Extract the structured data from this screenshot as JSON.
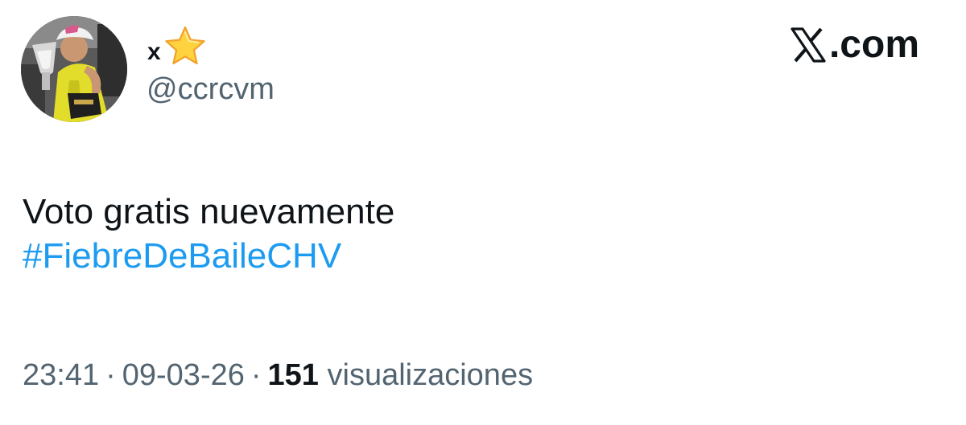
{
  "author": {
    "display_name": "x",
    "display_name_emoji": "star-emoji",
    "handle": "@ccrcvm",
    "avatar": "avatar-photo-trophy"
  },
  "brand": {
    "logo_icon": "x-logo-icon",
    "suffix": ".com"
  },
  "tweet": {
    "text_line": "Voto gratis nuevamente",
    "hashtag": "#FiebreDeBaileCHV"
  },
  "meta": {
    "time": "23:41",
    "date": "09-03-26",
    "separator": "·",
    "views_count": "151",
    "views_label": "visualizaciones"
  },
  "colors": {
    "text": "#0f1419",
    "secondary": "#536471",
    "link": "#1d9bf0",
    "star": "#ffcc33"
  }
}
